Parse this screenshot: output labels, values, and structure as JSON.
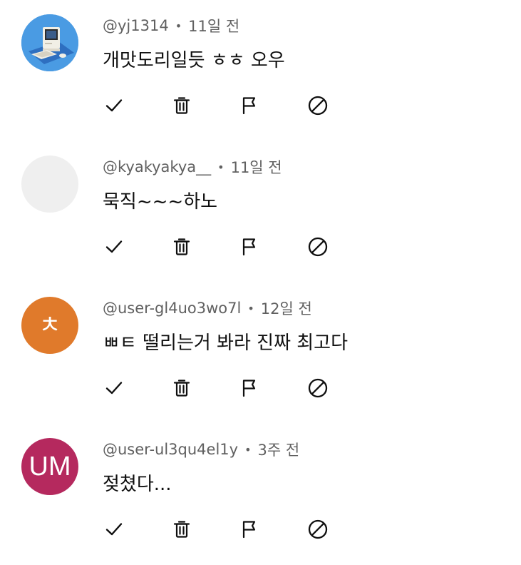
{
  "comments": [
    {
      "handle": "@yj1314",
      "separator": "•",
      "time": "11일 전",
      "text": "개맛도리일듯 ㅎㅎ 오우",
      "avatar": {
        "kind": "image",
        "icon": "retro-computer-icon",
        "bg": "#4a9be3"
      }
    },
    {
      "handle": "@kyakyakya__",
      "separator": "•",
      "time": "11일 전",
      "text": "묵직~~~하노",
      "avatar": {
        "kind": "blank",
        "bg": "#efefef"
      }
    },
    {
      "handle": "@user-gl4uo3wo7l",
      "separator": "•",
      "time": "12일 전",
      "text": "ㅃㅌ 떨리는거 봐라 진짜 최고다",
      "avatar": {
        "kind": "initials",
        "initials": "ㅊ",
        "bg": "#e07a2b"
      }
    },
    {
      "handle": "@user-ul3qu4el1y",
      "separator": "•",
      "time": "3주 전",
      "text": "젖쳤다...",
      "avatar": {
        "kind": "initials",
        "initials": "UM",
        "bg": "#b5295e"
      }
    }
  ],
  "actions": [
    {
      "name": "approve",
      "icon": "checkmark-icon"
    },
    {
      "name": "delete",
      "icon": "trash-icon"
    },
    {
      "name": "report",
      "icon": "flag-icon"
    },
    {
      "name": "block",
      "icon": "block-icon"
    }
  ]
}
